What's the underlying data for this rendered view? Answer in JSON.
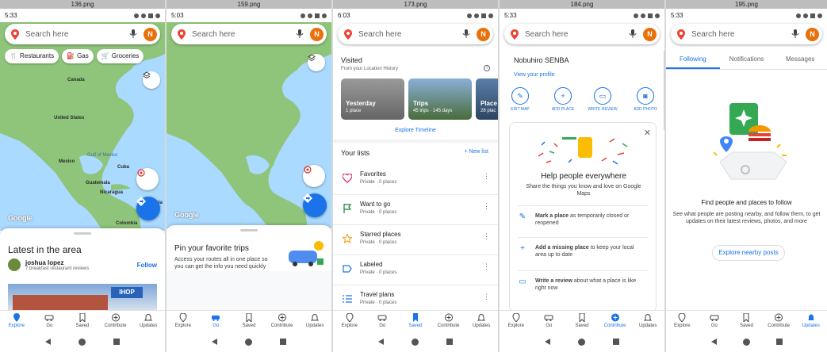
{
  "colors": {
    "accent": "#1a73e8",
    "avatar": "#e8710a",
    "map_land": "#8fc57a",
    "map_water": "#aadaff"
  },
  "panels": [
    {
      "filename": "136.png",
      "status_time": "5:33",
      "search_placeholder": "Search here",
      "avatar_letter": "N",
      "chips": [
        {
          "icon": "fork-knife-icon",
          "label": "Restaurants"
        },
        {
          "icon": "gas-pump-icon",
          "label": "Gas"
        },
        {
          "icon": "cart-icon",
          "label": "Groceries"
        }
      ],
      "map_labels": [
        "Canada",
        "United States",
        "Mexico",
        "Gulf of Mexico",
        "Cuba",
        "Guatemala",
        "Nicaragua",
        "Venezuela",
        "Colombia"
      ],
      "google": "Google",
      "sheet_title": "Latest in the area",
      "person_name": "joshua lopez",
      "person_sub": "7 breakfast restaurant reviews",
      "follow": "Follow",
      "photo_sign": "IHOP"
    },
    {
      "filename": "159.png",
      "status_time": "5:03",
      "search_placeholder": "Search here",
      "avatar_letter": "N",
      "google": "Google",
      "promo_title": "Pin your favorite trips",
      "promo_text": "Access your routes all in one place so you can get the info you need quickly"
    },
    {
      "filename": "173.png",
      "status_time": "6:03",
      "search_placeholder": "Search here",
      "avatar_letter": "N",
      "visited_title": "Visited",
      "visited_sub": "From your Location History",
      "cards": [
        {
          "label": "Yesterday",
          "sub": "1 place"
        },
        {
          "label": "Trips",
          "sub": "45 trips · 145 days"
        },
        {
          "label": "Place",
          "sub": "28 plac"
        }
      ],
      "explore_timeline": "Explore Timeline",
      "lists_title": "Your lists",
      "new_list": "+ New list",
      "lists": [
        {
          "name": "Favorites",
          "sub": "Private · 0 places"
        },
        {
          "name": "Want to go",
          "sub": "Private · 0 places"
        },
        {
          "name": "Starred places",
          "sub": "Private · 0 places"
        },
        {
          "name": "Labeled",
          "sub": "Private · 0 places"
        },
        {
          "name": "Travel plans",
          "sub": "Private · 0 places"
        }
      ]
    },
    {
      "filename": "184.png",
      "status_time": "5:33",
      "search_placeholder": "Search here",
      "avatar_letter": "N",
      "profile_name": "Nobuhiro SENBA",
      "view_profile": "View your profile",
      "actions": [
        "EDIT MAP",
        "ADD PLACE",
        "WRITE REVIEW",
        "ADD PHOTO"
      ],
      "help_title": "Help people everywhere",
      "help_sub": "Share the things you know and love on Google Maps",
      "tips": [
        {
          "bold": "Mark a place",
          "rest": " as temporarily closed or reopened"
        },
        {
          "bold": "Add a missing place",
          "rest": " to keep your local area up to date"
        },
        {
          "bold": "Write a review",
          "rest": " about what a place is like right now"
        }
      ]
    },
    {
      "filename": "195.png",
      "status_time": "5:33",
      "search_placeholder": "Search here",
      "avatar_letter": "N",
      "tabs": [
        "Following",
        "Notifications",
        "Messages"
      ],
      "find_title": "Find people and places to follow",
      "find_sub": "See what people are posting nearby, and follow them, to get updates on their latest reviews, photos, and more",
      "explore_btn": "Explore nearby posts"
    }
  ],
  "nav": {
    "items": [
      "Explore",
      "Go",
      "Saved",
      "Contribute",
      "Updates"
    ],
    "active_per_panel": [
      0,
      1,
      2,
      3,
      4
    ]
  }
}
